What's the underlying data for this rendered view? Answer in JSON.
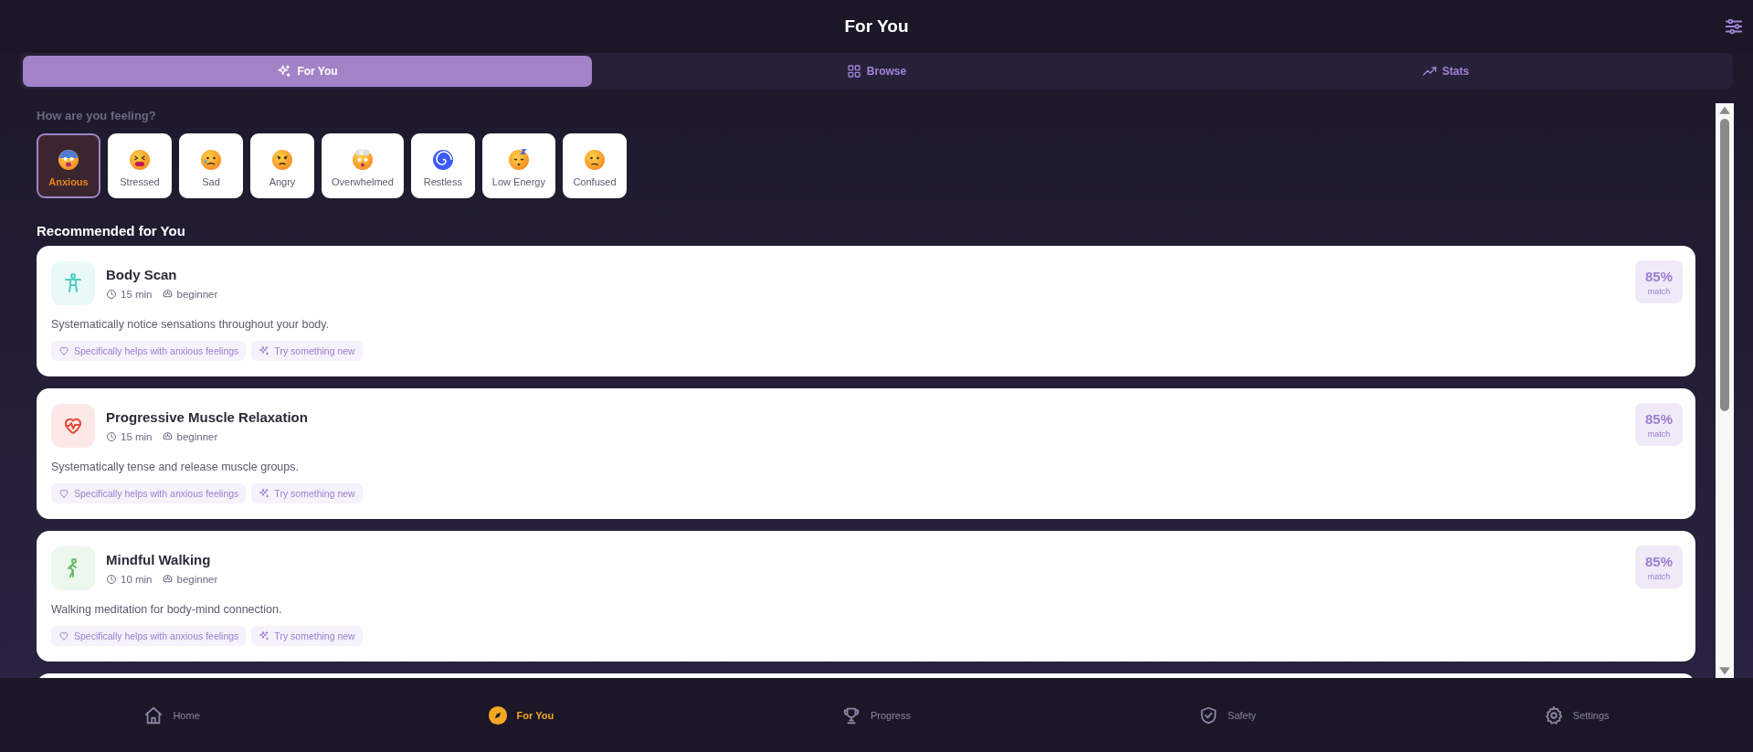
{
  "header": {
    "title": "For You"
  },
  "tabs": [
    {
      "label": "For You",
      "selected": true
    },
    {
      "label": "Browse",
      "selected": false
    },
    {
      "label": "Stats",
      "selected": false
    }
  ],
  "mood_prompt": "How are you feeling?",
  "moods": [
    {
      "label": "Anxious",
      "selected": true
    },
    {
      "label": "Stressed",
      "selected": false
    },
    {
      "label": "Sad",
      "selected": false
    },
    {
      "label": "Angry",
      "selected": false
    },
    {
      "label": "Overwhelmed",
      "selected": false
    },
    {
      "label": "Restless",
      "selected": false
    },
    {
      "label": "Low Energy",
      "selected": false
    },
    {
      "label": "Confused",
      "selected": false
    }
  ],
  "section_title": "Recommended for You",
  "recommendations": [
    {
      "title": "Body Scan",
      "duration": "15 min",
      "difficulty": "beginner",
      "description": "Systematically notice sensations throughout your body.",
      "tags": [
        {
          "kind": "helps",
          "text": "Specifically helps with anxious feelings"
        },
        {
          "kind": "new",
          "text": "Try something new"
        }
      ],
      "match": "85%",
      "match_label": "match",
      "color": "#4ecdc4"
    },
    {
      "title": "Progressive Muscle Relaxation",
      "duration": "15 min",
      "difficulty": "beginner",
      "description": "Systematically tense and release muscle groups.",
      "tags": [
        {
          "kind": "helps",
          "text": "Specifically helps with anxious feelings"
        },
        {
          "kind": "new",
          "text": "Try something new"
        }
      ],
      "match": "85%",
      "match_label": "match",
      "color": "#e74c3c"
    },
    {
      "title": "Mindful Walking",
      "duration": "10 min",
      "difficulty": "beginner",
      "description": "Walking meditation for body-mind connection.",
      "tags": [
        {
          "kind": "helps",
          "text": "Specifically helps with anxious feelings"
        },
        {
          "kind": "new",
          "text": "Try something new"
        }
      ],
      "match": "85%",
      "match_label": "match",
      "color": "#66bb6a"
    }
  ],
  "more_cards_below": true,
  "nav": [
    {
      "label": "Home",
      "selected": false
    },
    {
      "label": "For You",
      "selected": true
    },
    {
      "label": "Progress",
      "selected": false
    },
    {
      "label": "Safety",
      "selected": false
    },
    {
      "label": "Settings",
      "selected": false
    }
  ]
}
